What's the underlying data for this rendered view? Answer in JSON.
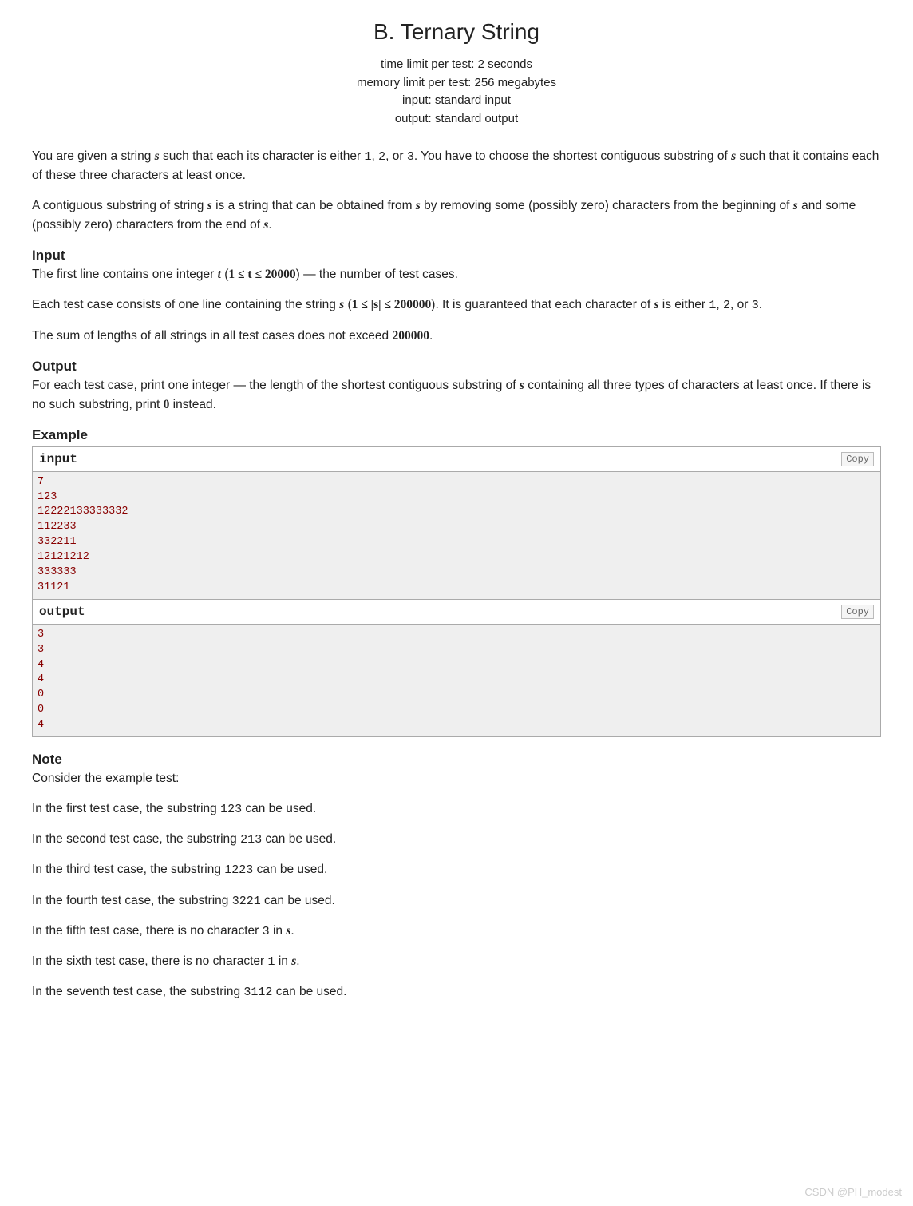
{
  "title": "B. Ternary String",
  "limits": {
    "time": "time limit per test: 2 seconds",
    "memory": "memory limit per test: 256 megabytes",
    "input": "input: standard input",
    "output": "output: standard output"
  },
  "intro": {
    "p1_a": "You are given a string ",
    "p1_b": " such that each its character is either ",
    "c1": "1",
    "p1_c": ", ",
    "c2": "2",
    "p1_d": ", or ",
    "c3": "3",
    "p1_e": ". You have to choose the shortest contiguous substring of ",
    "p1_f": " such that it contains each of these three characters at least once.",
    "p2_a": "A contiguous substring of string ",
    "p2_b": " is a string that can be obtained from ",
    "p2_c": " by removing some (possibly zero) characters from the beginning of ",
    "p2_d": " and some (possibly zero) characters from the end of ",
    "p2_e": "."
  },
  "input_section": {
    "header": "Input",
    "p1_a": "The first line contains one integer ",
    "p1_var_t": "t",
    "p1_b": " (",
    "p1_math": "1 ≤ t ≤ 20000",
    "p1_c": ") — the number of test cases.",
    "p2_a": "Each test case consists of one line containing the string ",
    "p2_b": " (",
    "p2_math": "1 ≤ |s| ≤ 200000",
    "p2_c": "). It is guaranteed that each character of ",
    "p2_d": " is either ",
    "p2_e": ", ",
    "p2_f": ", or ",
    "p2_g": ".",
    "p3_a": "The sum of lengths of all strings in all test cases does not exceed ",
    "p3_num": "200000",
    "p3_b": "."
  },
  "output_section": {
    "header": "Output",
    "p1_a": "For each test case, print one integer — the length of the shortest contiguous substring of ",
    "p1_b": " containing all three types of characters at least once. If there is no such substring, print ",
    "p1_zero": "0",
    "p1_c": " instead."
  },
  "example": {
    "header": "Example",
    "input_label": "input",
    "output_label": "output",
    "copy_label": "Copy",
    "input_data": "7\n123\n12222133333332\n112233\n332211\n12121212\n333333\n31121",
    "output_data": "3\n3\n4\n4\n0\n0\n4"
  },
  "note": {
    "header": "Note",
    "p0": "Consider the example test:",
    "lines": [
      {
        "pre": "In the first test case, the substring ",
        "code": "123",
        "post": " can be used."
      },
      {
        "pre": "In the second test case, the substring ",
        "code": "213",
        "post": " can be used."
      },
      {
        "pre": "In the third test case, the substring ",
        "code": "1223",
        "post": " can be used."
      },
      {
        "pre": "In the fourth test case, the substring ",
        "code": "3221",
        "post": " can be used."
      }
    ],
    "l5_a": "In the fifth test case, there is no character ",
    "l5_code": "3",
    "l5_b": " in ",
    "l5_c": ".",
    "l6_a": "In the sixth test case, there is no character ",
    "l6_code": "1",
    "l6_b": " in ",
    "l6_c": ".",
    "l7_a": "In the seventh test case, the substring ",
    "l7_code": "3112",
    "l7_b": " can be used."
  },
  "var_s": "s",
  "watermark": "CSDN @PH_modest"
}
